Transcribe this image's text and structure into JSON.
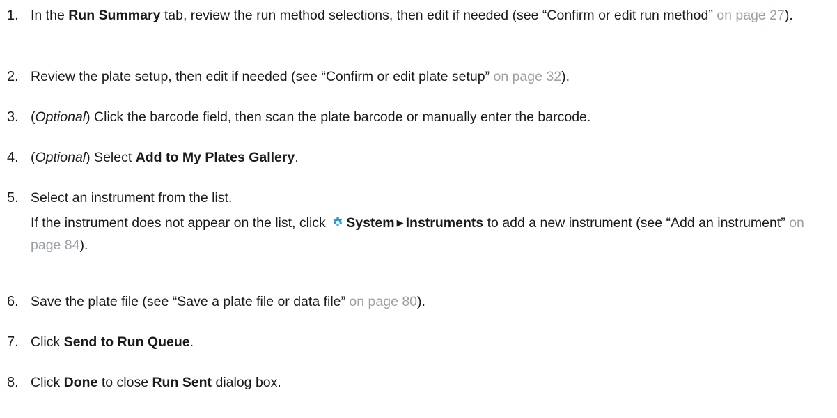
{
  "steps": [
    {
      "num": "1.",
      "t1": "In the ",
      "b1": "Run Summary",
      "t2": " tab, review the run method selections, then edit if needed (see “Confirm or edit run method” ",
      "link": "on page 27",
      "t3": ")."
    },
    {
      "num": "2.",
      "t1": "Review the plate setup, then edit if needed (see “Confirm or edit plate setup” ",
      "link": "on page 32",
      "t2": ")."
    },
    {
      "num": "3.",
      "open": "(",
      "opt": "Optional",
      "close": ")",
      "t1": " Click the barcode field, then scan the plate barcode or manually enter the barcode."
    },
    {
      "num": "4.",
      "open": "(",
      "opt": "Optional",
      "close": ")",
      "t1": " Select ",
      "b1": "Add to My Plates Gallery",
      "t2": "."
    },
    {
      "num": "5.",
      "t1": "Select an instrument from the list.",
      "c1": "If the instrument does not appear on the list, click ",
      "gear_icon": "gear-icon",
      "b1": "System",
      "arrow": "▶",
      "b2": "Instruments",
      "c2": " to add a new instrument (see “Add an instrument” ",
      "link": "on page 84",
      "c3": ")."
    },
    {
      "num": "6.",
      "t1": "Save the plate file (see “Save a plate file or data file” ",
      "link": "on page 80",
      "t2": ")."
    },
    {
      "num": "7.",
      "t1": "Click ",
      "b1": "Send to Run Queue",
      "t2": "."
    },
    {
      "num": "8.",
      "t1": "Click ",
      "b1": "Done",
      "t2": " to close ",
      "b2": "Run Sent",
      "t3": " dialog box."
    }
  ],
  "colors": {
    "text": "#1a1a1a",
    "link": "#9aa0a6",
    "gear": "#1e9bd7"
  }
}
